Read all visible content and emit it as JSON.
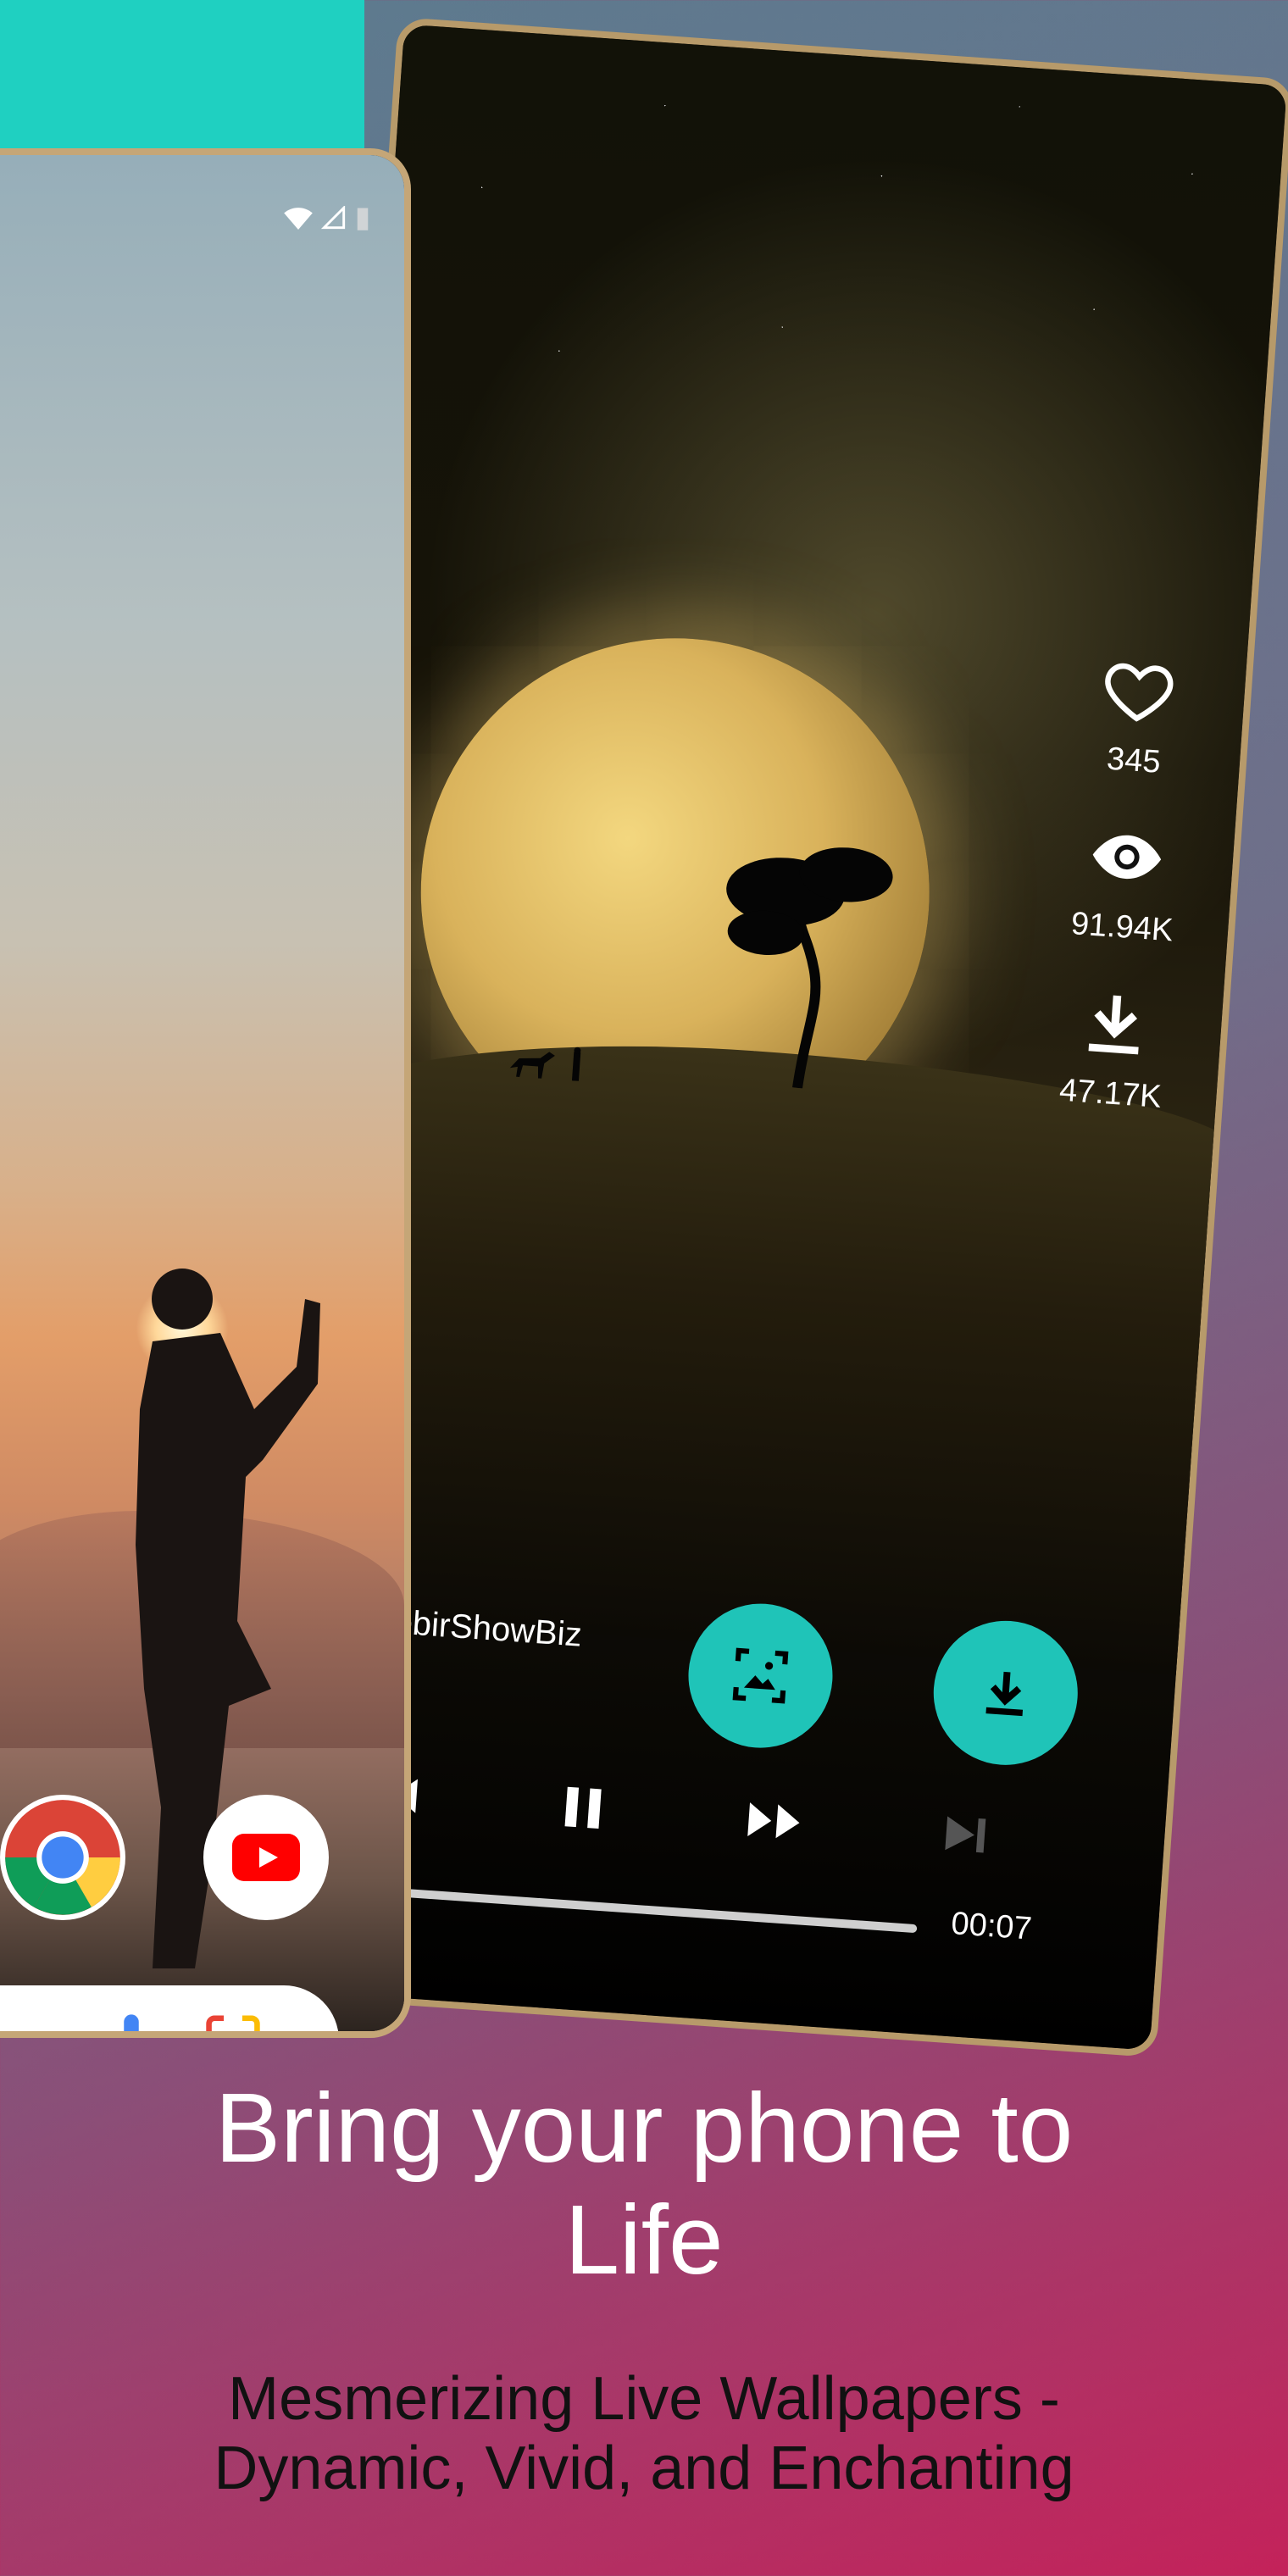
{
  "player": {
    "likes": "345",
    "views": "91.94K",
    "downloads": "47.17K",
    "creator": "SabbirShowBiz",
    "time": "00:07",
    "progress": 0.13
  },
  "icons": {
    "like": "heart-icon",
    "views": "eye-icon",
    "downloads": "download-icon",
    "preview": "preview-icon",
    "download_fab": "download-icon",
    "rewind": "rewind-icon",
    "pause": "pause-icon",
    "forward": "fast-forward-icon",
    "next": "skip-next-icon"
  },
  "home_screen": {
    "apps": [
      "Chrome",
      "YouTube"
    ]
  },
  "promo": {
    "headline_line1": "Bring your phone to",
    "headline_line2": "Life",
    "sub_line1": "Mesmerizing Live Wallpapers -",
    "sub_line2": "Dynamic, Vivid, and Enchanting"
  },
  "colors": {
    "accent": "#1fc4b8",
    "corner": "#1fd0c1",
    "frame": "#b79a6a"
  }
}
